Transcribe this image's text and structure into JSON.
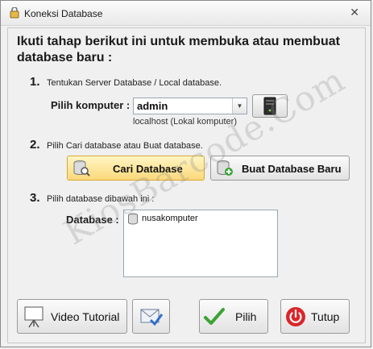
{
  "window": {
    "title": "Koneksi Database",
    "close_glyph": "✕"
  },
  "heading": "Ikuti tahap berikut ini untuk membuka atau membuat database baru :",
  "step1": {
    "number": "1.",
    "text": "Tentukan Server Database / Local database.",
    "label": "Pilih komputer :",
    "computer_value": "admin",
    "hint": "localhost (Lokal komputer)",
    "server_icon": "server-icon"
  },
  "step2": {
    "number": "2.",
    "text": "Pilih Cari database atau Buat database.",
    "find_button": "Cari Database",
    "create_button": "Buat Database Baru"
  },
  "step3": {
    "number": "3.",
    "text": "Pilih database dibawah ini :",
    "label": "Database :",
    "items": [
      "nusakomputer"
    ]
  },
  "footer": {
    "video_button": "Video Tutorial",
    "choose_button": "Pilih",
    "close_button": "Tutup"
  },
  "watermark": "KiosBarcode.Com",
  "colors": {
    "highlight_button": "#fbd97a",
    "close_red": "#d9262b",
    "check_green": "#3aa335"
  }
}
